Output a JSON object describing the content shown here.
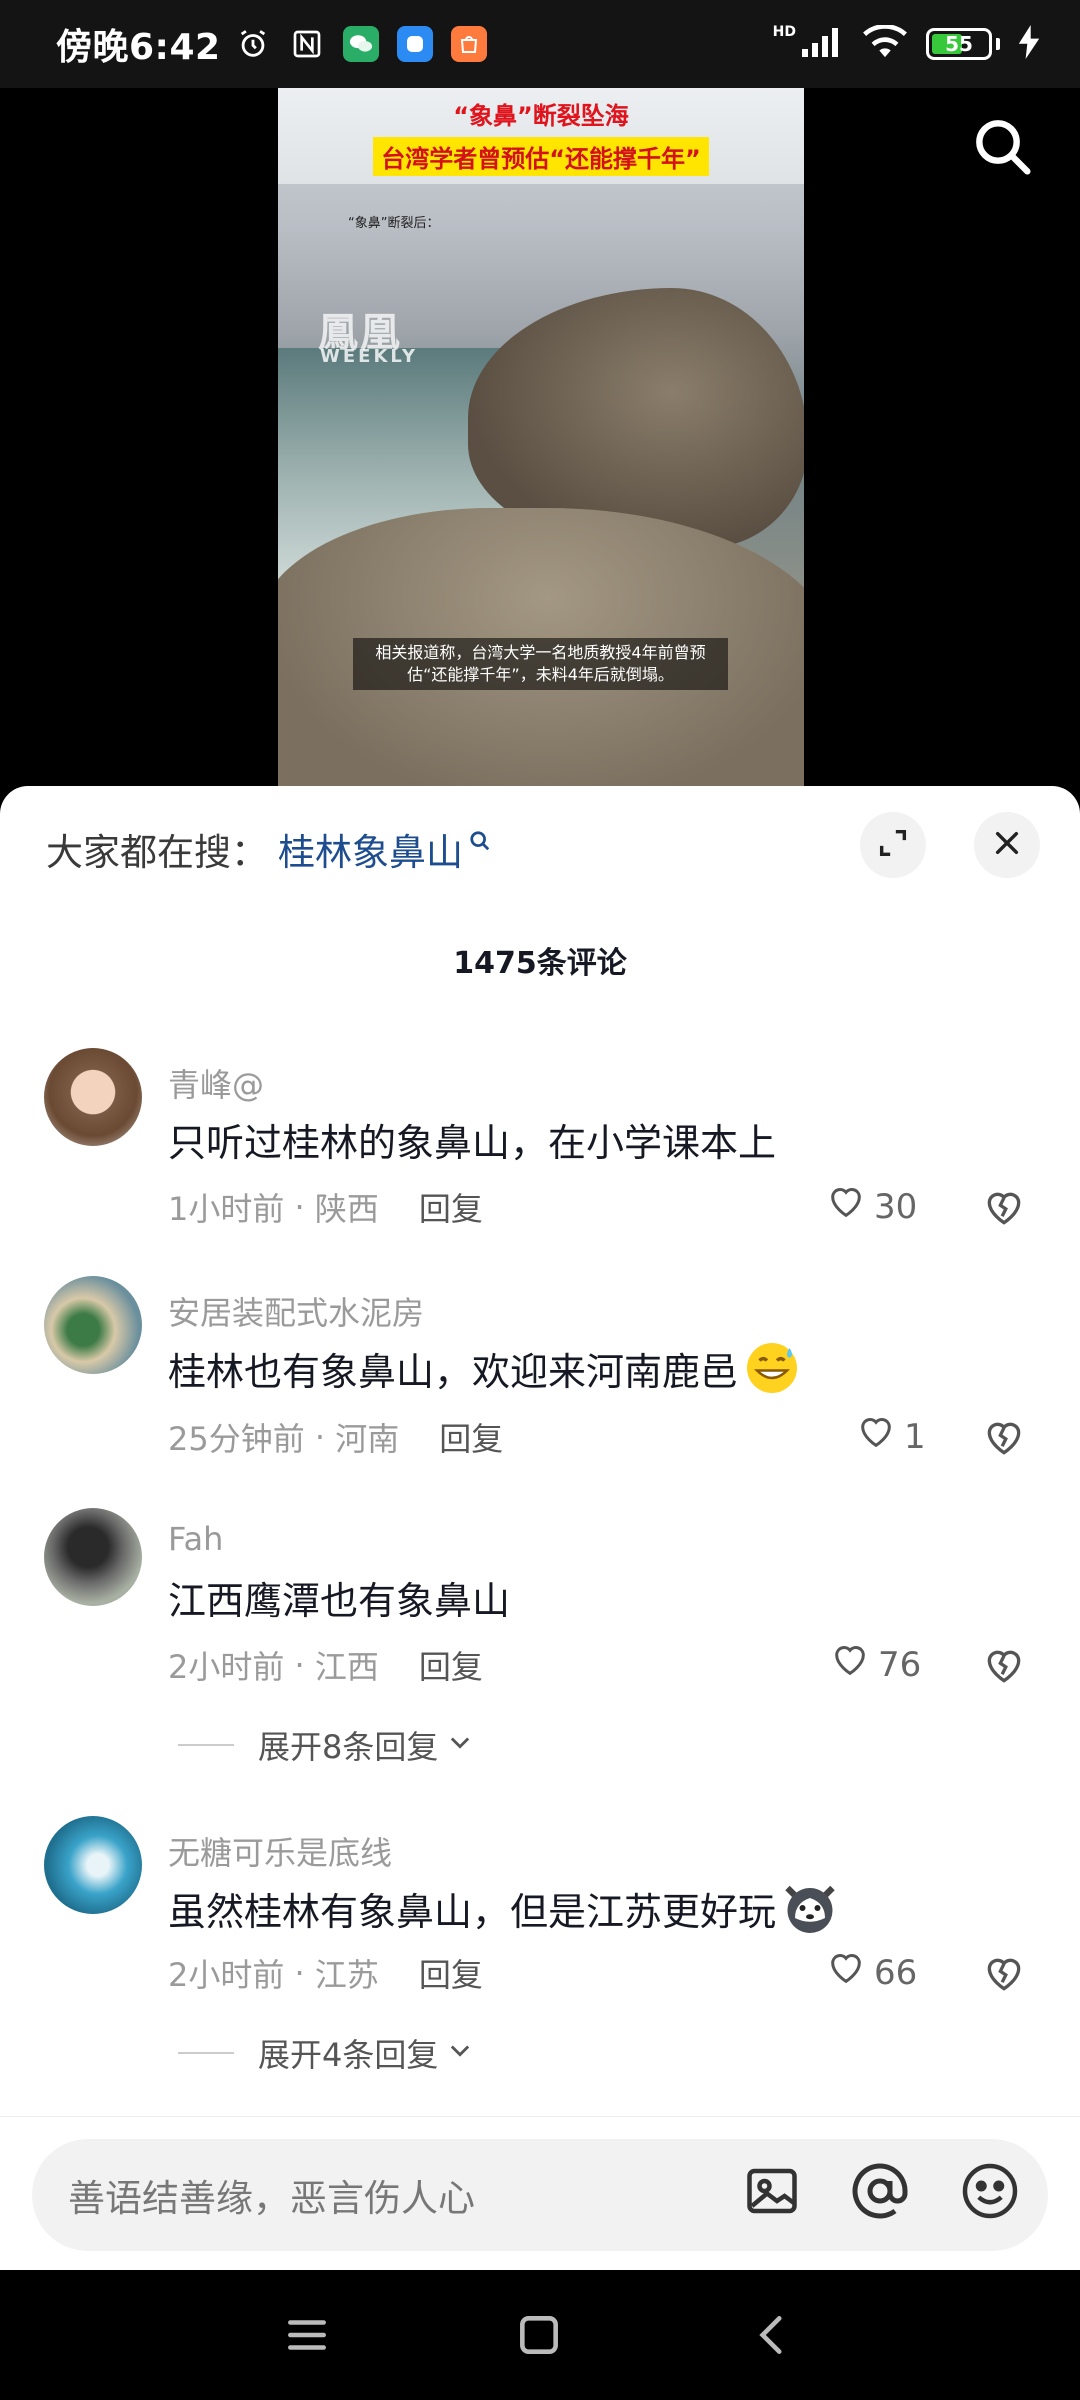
{
  "status_bar": {
    "time": "傍晚6:42",
    "network": "HD",
    "battery": "55",
    "battery_level": 0.55
  },
  "video": {
    "headline_top": "“象鼻”断裂坠海",
    "headline_bottom": "台湾学者曾预估“还能撑千年”",
    "small_label": "“象鼻”断裂后：",
    "watermark": "鳳凰",
    "watermark_sub": "WEEKLY",
    "caption": "相关报道称，台湾大学一名地质教授4年前曾预估“还能撑千年”，未料4年后就倒塌。"
  },
  "panel": {
    "trending_label": "大家都在搜：",
    "trending_link": "桂林象鼻山",
    "comment_count": "1475条评论"
  },
  "comments": [
    {
      "user": "青峰@",
      "text": "只听过桂林的象鼻山，在小学课本上",
      "time": "1小时前",
      "location": "陕西",
      "reply": "回复",
      "likes": "30"
    },
    {
      "user": "安居装配式水泥房",
      "text": "桂林也有象鼻山，欢迎来河南鹿邑",
      "time": "25分钟前",
      "location": "河南",
      "reply": "回复",
      "likes": "1"
    },
    {
      "user": "Fah",
      "text": "江西鹰潭也有象鼻山",
      "time": "2小时前",
      "location": "江西",
      "reply": "回复",
      "likes": "76",
      "expand": "展开8条回复"
    },
    {
      "user": "无糖可乐是底线",
      "text": "虽然桂林有象鼻山，但是江苏更好玩",
      "time": "2小时前",
      "location": "江苏",
      "reply": "回复",
      "likes": "66",
      "expand": "展开4条回复"
    }
  ],
  "input": {
    "placeholder": "善语结善缘，恶言伤人心"
  }
}
